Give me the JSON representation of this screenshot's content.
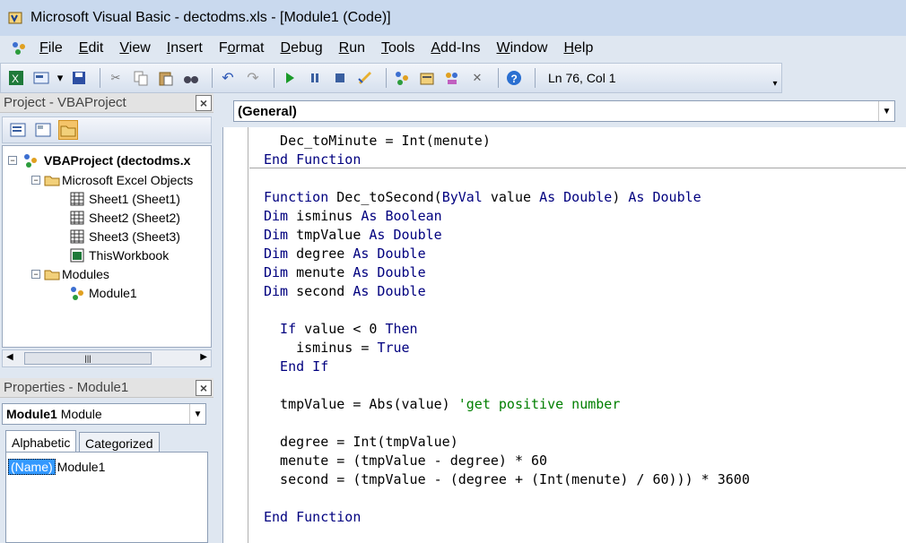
{
  "window": {
    "title": "Microsoft Visual Basic - dectodms.xls - [Module1 (Code)]"
  },
  "menu": [
    {
      "label": "File",
      "accel": "F",
      "rest": "ile"
    },
    {
      "label": "Edit",
      "accel": "E",
      "rest": "dit"
    },
    {
      "label": "View",
      "accel": "V",
      "rest": "iew"
    },
    {
      "label": "Insert",
      "accel": "I",
      "rest": "nsert"
    },
    {
      "label": "Format",
      "accel": "o",
      "pre": "F",
      "rest": "rmat"
    },
    {
      "label": "Debug",
      "accel": "D",
      "rest": "ebug"
    },
    {
      "label": "Run",
      "accel": "R",
      "rest": "un"
    },
    {
      "label": "Tools",
      "accel": "T",
      "rest": "ools"
    },
    {
      "label": "Add-Ins",
      "accel": "A",
      "rest": "dd-Ins"
    },
    {
      "label": "Window",
      "accel": "W",
      "rest": "indow"
    },
    {
      "label": "Help",
      "accel": "H",
      "rest": "elp"
    }
  ],
  "toolbar": {
    "position": "Ln 76, Col 1"
  },
  "project": {
    "title": "Project - VBAProject",
    "close": "×",
    "root": "VBAProject (dectodms.x",
    "folder_objects": "Microsoft Excel Objects",
    "sheet1": "Sheet1 (Sheet1)",
    "sheet2": "Sheet2 (Sheet2)",
    "sheet3": "Sheet3 (Sheet3)",
    "workbook": "ThisWorkbook",
    "folder_modules": "Modules",
    "module1": "Module1"
  },
  "properties": {
    "title": "Properties - Module1",
    "close": "×",
    "object_bold": "Module1",
    "object_type": "Module",
    "tab_alpha": "Alphabetic",
    "tab_cat": "Categorized",
    "prop_name": "(Name)",
    "prop_value": "Module1"
  },
  "code_editor": {
    "general": "(General)",
    "lines": [
      {
        "parts": [
          {
            "t": "  Dec_toMinute = Int(menute)",
            "c": "tx"
          }
        ]
      },
      {
        "parts": [
          {
            "t": "End Function",
            "c": "kw"
          }
        ]
      },
      {
        "parts": []
      },
      {
        "parts": [
          {
            "t": "Function ",
            "c": "kw"
          },
          {
            "t": "Dec_toSecond(",
            "c": "tx"
          },
          {
            "t": "ByVal",
            "c": "kw"
          },
          {
            "t": " value ",
            "c": "tx"
          },
          {
            "t": "As Double",
            "c": "kw"
          },
          {
            "t": ") ",
            "c": "tx"
          },
          {
            "t": "As Double",
            "c": "kw"
          }
        ]
      },
      {
        "parts": [
          {
            "t": "Dim",
            "c": "kw"
          },
          {
            "t": " isminus ",
            "c": "tx"
          },
          {
            "t": "As Boolean",
            "c": "kw"
          }
        ]
      },
      {
        "parts": [
          {
            "t": "Dim",
            "c": "kw"
          },
          {
            "t": " tmpValue ",
            "c": "tx"
          },
          {
            "t": "As Double",
            "c": "kw"
          }
        ]
      },
      {
        "parts": [
          {
            "t": "Dim",
            "c": "kw"
          },
          {
            "t": " degree ",
            "c": "tx"
          },
          {
            "t": "As Double",
            "c": "kw"
          }
        ]
      },
      {
        "parts": [
          {
            "t": "Dim",
            "c": "kw"
          },
          {
            "t": " menute ",
            "c": "tx"
          },
          {
            "t": "As Double",
            "c": "kw"
          }
        ]
      },
      {
        "parts": [
          {
            "t": "Dim",
            "c": "kw"
          },
          {
            "t": " second ",
            "c": "tx"
          },
          {
            "t": "As Double",
            "c": "kw"
          }
        ]
      },
      {
        "parts": []
      },
      {
        "parts": [
          {
            "t": "  If",
            "c": "kw"
          },
          {
            "t": " value < 0 ",
            "c": "tx"
          },
          {
            "t": "Then",
            "c": "kw"
          }
        ]
      },
      {
        "parts": [
          {
            "t": "    isminus = ",
            "c": "tx"
          },
          {
            "t": "True",
            "c": "kw"
          }
        ]
      },
      {
        "parts": [
          {
            "t": "  End If",
            "c": "kw"
          }
        ]
      },
      {
        "parts": []
      },
      {
        "parts": [
          {
            "t": "  tmpValue = Abs(value) ",
            "c": "tx"
          },
          {
            "t": "'get positive number",
            "c": "cm"
          }
        ]
      },
      {
        "parts": []
      },
      {
        "parts": [
          {
            "t": "  degree = Int(tmpValue)",
            "c": "tx"
          }
        ]
      },
      {
        "parts": [
          {
            "t": "  menute = (tmpValue - degree) * 60",
            "c": "tx"
          }
        ]
      },
      {
        "parts": [
          {
            "t": "  second = (tmpValue - (degree + (Int(menute) / 60))) * 3600",
            "c": "tx"
          }
        ]
      },
      {
        "parts": []
      },
      {
        "parts": [
          {
            "t": "End Function",
            "c": "kw"
          }
        ]
      }
    ]
  }
}
